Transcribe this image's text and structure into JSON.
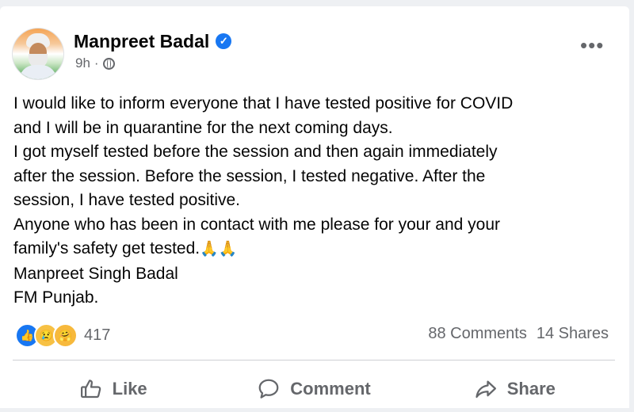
{
  "post": {
    "author": "Manpreet Badal",
    "verified_icon": "verified-check-icon",
    "time": "9h",
    "separator": "·",
    "audience_icon": "globe-icon",
    "menu_label": "•••",
    "text_lines": [
      "I would like to inform everyone that I have tested positive for COVID",
      "and I will be in quarantine for the next coming days.",
      "I got myself tested before the session and then again immediately",
      "after the session. Before the session, I tested negative. After the",
      "session, I have tested positive.",
      "Anyone who has been in contact with me please for your and your",
      "family's safety get tested.",
      "Manpreet Singh Badal",
      "FM Punjab."
    ],
    "pray_emoji": "🙏🙏"
  },
  "reactions": {
    "icons": [
      "like-reaction-icon",
      "sad-reaction-icon",
      "care-reaction-icon"
    ],
    "like_glyph": "👍",
    "sad_glyph": "😢",
    "care_glyph": "🤗",
    "count": "417"
  },
  "stats": {
    "comments": "88 Comments",
    "shares": "14 Shares"
  },
  "actions": {
    "like": "Like",
    "comment": "Comment",
    "share": "Share"
  },
  "colors": {
    "accent": "#1877f2",
    "secondary_text": "#65676b",
    "primary_text": "#050505"
  }
}
